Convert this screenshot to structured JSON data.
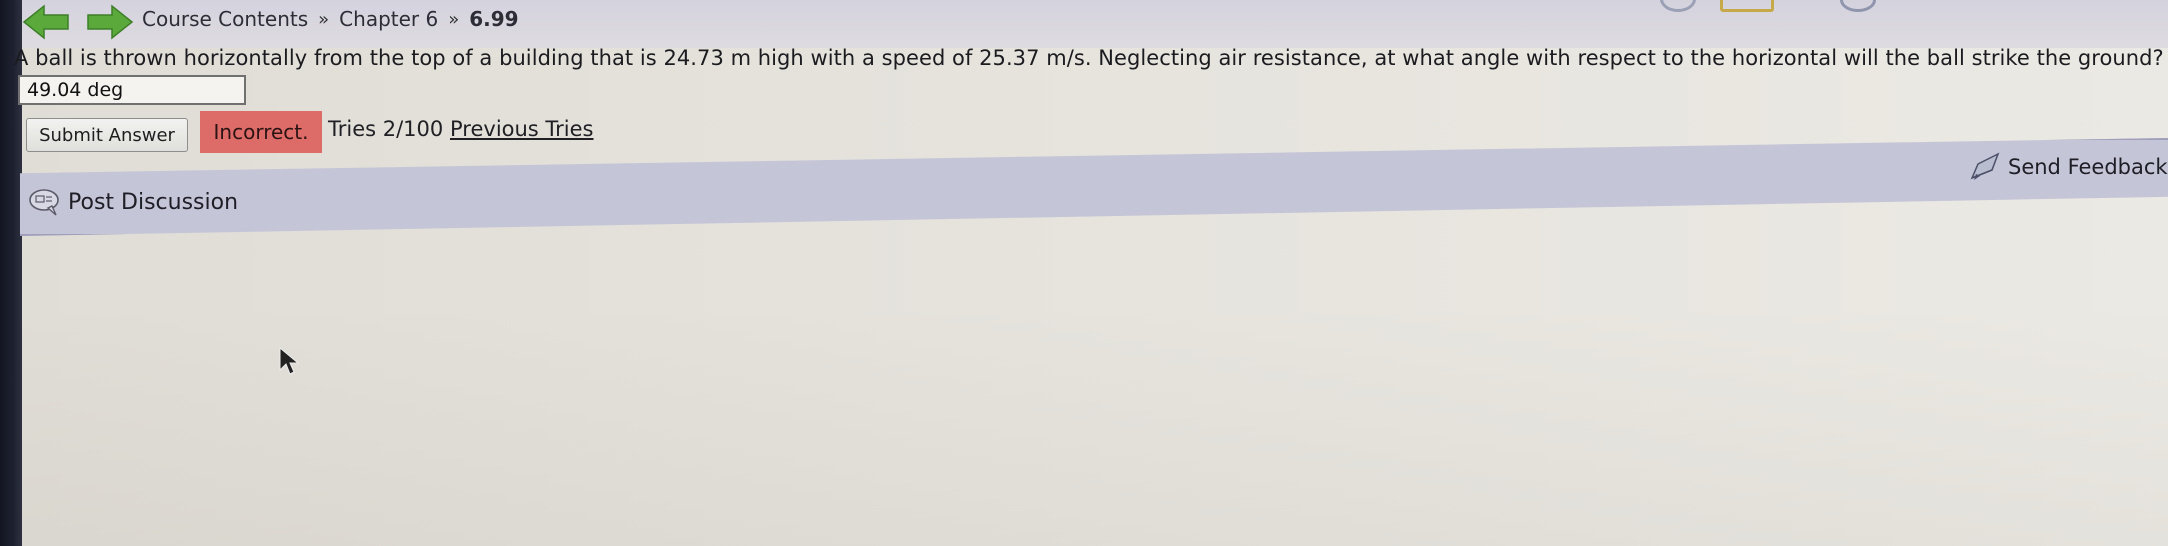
{
  "nav": {
    "back_icon": "back-arrow-icon",
    "forward_icon": "forward-arrow-icon",
    "arrow_color": "#5aa93a"
  },
  "breadcrumb": {
    "items": [
      "Course Contents",
      "Chapter 6"
    ],
    "separator": "»",
    "current": "6.99"
  },
  "problem": {
    "question": "A ball is thrown horizontally from the top of a building that is 24.73 m high with a speed of 25.37 m/s. Neglecting air resistance, at what angle with respect to the horizontal will the ball strike the ground?",
    "answer_value": "49.04 deg"
  },
  "submission": {
    "submit_label": "Submit Answer",
    "status": "Incorrect.",
    "status_color": "#dd6b68",
    "tries": "Tries 2/100",
    "previous_tries_label": "Previous Tries"
  },
  "discussion": {
    "post_label": "Post Discussion",
    "post_icon": "discussion-bubble-icon",
    "feedback_label": "Send Feedback",
    "feedback_icon": "feedback-pen-icon",
    "bar_color": "#c5c5d8"
  }
}
